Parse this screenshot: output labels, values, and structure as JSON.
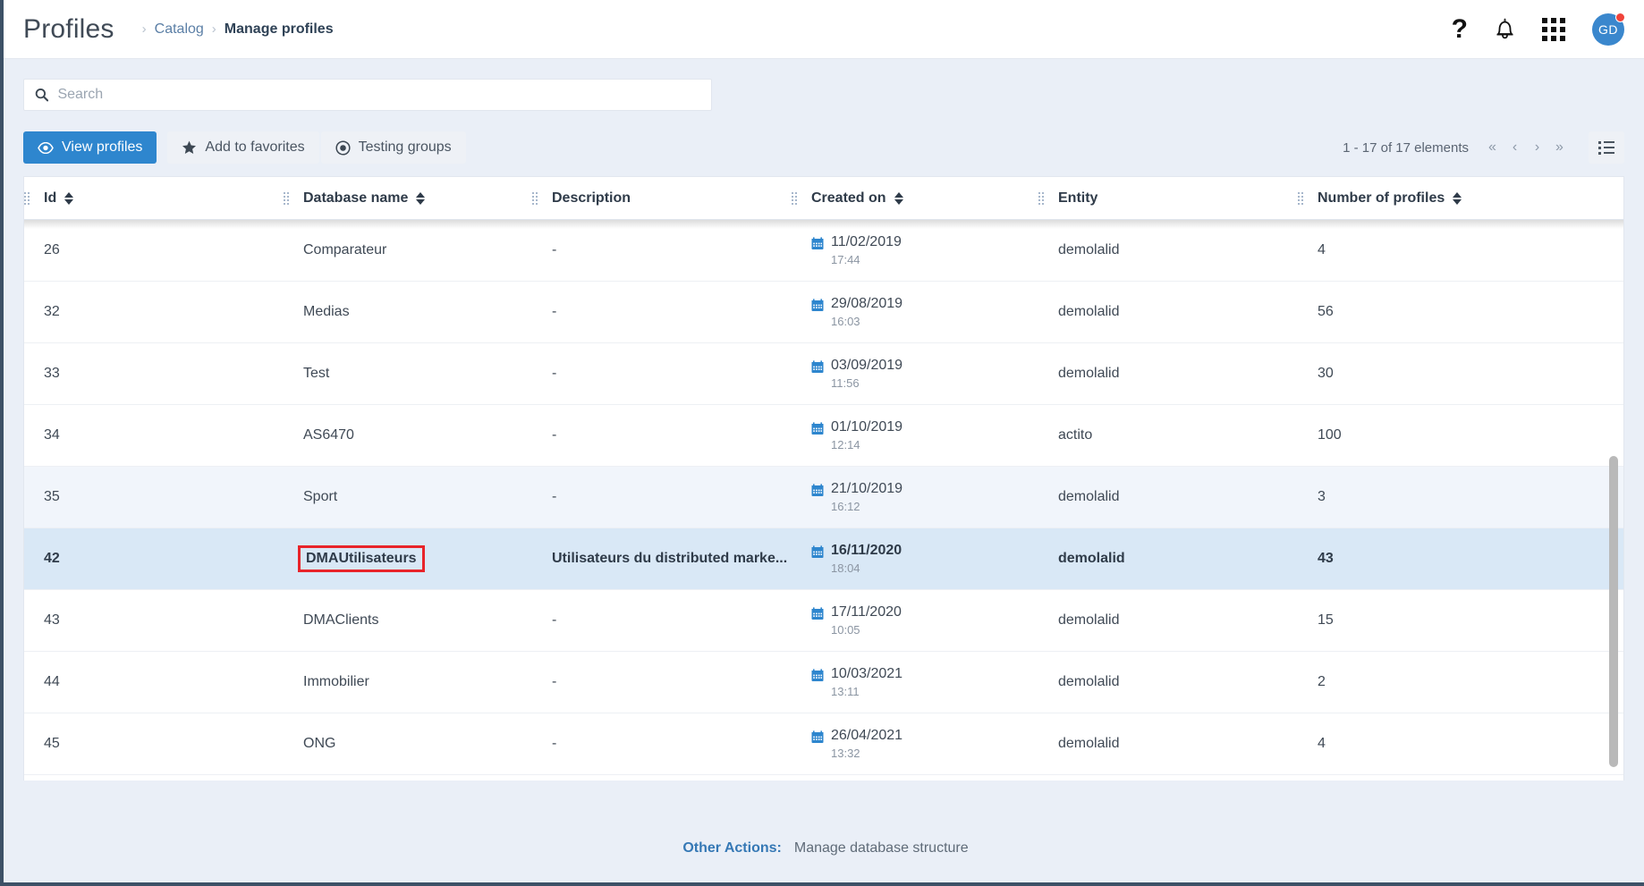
{
  "header": {
    "title": "Profiles",
    "breadcrumb": {
      "parent": "Catalog",
      "current": "Manage profiles",
      "separator": "›"
    },
    "icons": {
      "help": "?",
      "help_name": "help-icon",
      "bell_name": "bell-icon",
      "apps_name": "apps-grid-icon"
    },
    "avatar": {
      "initials": "GD",
      "badge_color": "#f0433a",
      "bg_color": "#3a87cd"
    }
  },
  "search": {
    "placeholder": "Search",
    "value": "",
    "icon": "search-icon"
  },
  "toolbar": {
    "buttons": [
      {
        "label": "View profiles",
        "icon": "eye-icon",
        "style": "primary"
      },
      {
        "label": "Add to favorites",
        "icon": "star-icon",
        "style": "ghost"
      },
      {
        "label": "Testing groups",
        "icon": "target-icon",
        "style": "ghost"
      }
    ],
    "pagination": {
      "count_text": "1 - 17 of 17 elements",
      "first": "«",
      "prev": "‹",
      "next": "›",
      "last": "»"
    },
    "view_toggle": "list-view-icon"
  },
  "table": {
    "columns": [
      {
        "label": "Id",
        "sortable": true
      },
      {
        "label": "Database name",
        "sortable": true
      },
      {
        "label": "Description",
        "sortable": false
      },
      {
        "label": "Created on",
        "sortable": true
      },
      {
        "label": "Entity",
        "sortable": false
      },
      {
        "label": "Number of profiles",
        "sortable": true
      }
    ],
    "rows": [
      {
        "id": "26",
        "name": "Comparateur",
        "description": "-",
        "date": "11/02/2019",
        "time": "17:44",
        "entity": "demolalid",
        "profiles": "4",
        "state": "normal",
        "highlight_name": false
      },
      {
        "id": "32",
        "name": "Medias",
        "description": "-",
        "date": "29/08/2019",
        "time": "16:03",
        "entity": "demolalid",
        "profiles": "56",
        "state": "normal",
        "highlight_name": false
      },
      {
        "id": "33",
        "name": "Test",
        "description": "-",
        "date": "03/09/2019",
        "time": "11:56",
        "entity": "demolalid",
        "profiles": "30",
        "state": "normal",
        "highlight_name": false
      },
      {
        "id": "34",
        "name": "AS6470",
        "description": "-",
        "date": "01/10/2019",
        "time": "12:14",
        "entity": "actito",
        "profiles": "100",
        "state": "normal",
        "highlight_name": false
      },
      {
        "id": "35",
        "name": "Sport",
        "description": "-",
        "date": "21/10/2019",
        "time": "16:12",
        "entity": "demolalid",
        "profiles": "3",
        "state": "alt",
        "highlight_name": false
      },
      {
        "id": "42",
        "name": "DMAUtilisateurs",
        "description": "Utilisateurs du distributed marke...",
        "date": "16/11/2020",
        "time": "18:04",
        "entity": "demolalid",
        "profiles": "43",
        "state": "sel",
        "highlight_name": true
      },
      {
        "id": "43",
        "name": "DMAClients",
        "description": "-",
        "date": "17/11/2020",
        "time": "10:05",
        "entity": "demolalid",
        "profiles": "15",
        "state": "normal",
        "highlight_name": false
      },
      {
        "id": "44",
        "name": "Immobilier",
        "description": "-",
        "date": "10/03/2021",
        "time": "13:11",
        "entity": "demolalid",
        "profiles": "2",
        "state": "normal",
        "highlight_name": false
      },
      {
        "id": "45",
        "name": "ONG",
        "description": "-",
        "date": "26/04/2021",
        "time": "13:32",
        "entity": "demolalid",
        "profiles": "4",
        "state": "normal",
        "highlight_name": false
      }
    ]
  },
  "footer": {
    "label": "Other Actions:",
    "link": "Manage database structure"
  },
  "colors": {
    "accent": "#2e86ce",
    "selected_row": "#d9e8f6",
    "alt_row": "#f1f5fb",
    "annotation": "#e8242a",
    "page_bg": "#eaeff7"
  }
}
